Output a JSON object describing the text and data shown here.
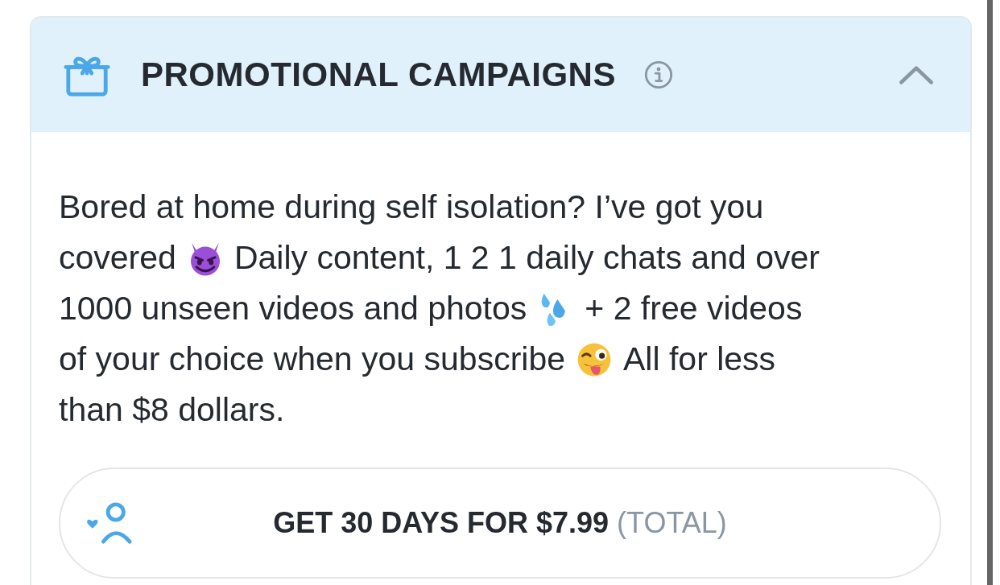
{
  "panel": {
    "title": "PROMOTIONAL CAMPAIGNS",
    "expanded": true
  },
  "description": [
    [
      "Bored at home during self isolation? I’ve got you"
    ],
    [
      "covered",
      "Daily content, 1 2 1 daily chats and over"
    ],
    [
      "1000 unseen videos and photos",
      "+ 2 free videos"
    ],
    [
      "of your choice when you subscribe",
      "All for less"
    ],
    [
      "than $8 dollars."
    ]
  ],
  "subscribe_button": {
    "label": "GET 30 DAYS FOR $7.99",
    "note": "(TOTAL)"
  }
}
